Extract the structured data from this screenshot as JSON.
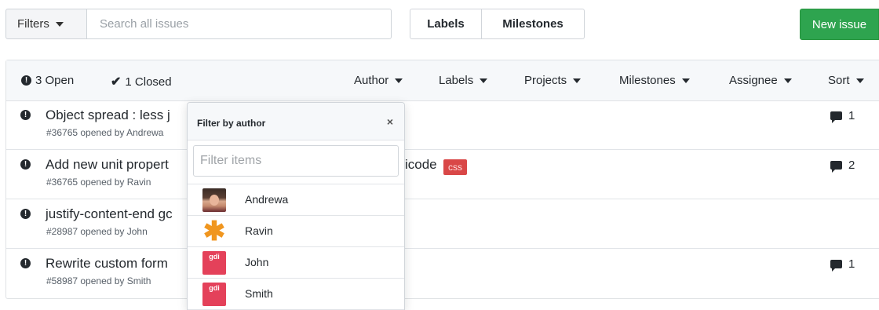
{
  "toolbar": {
    "filters_label": "Filters",
    "search_placeholder": "Search all issues",
    "labels_btn": "Labels",
    "milestones_btn": "Milestones",
    "new_issue_btn": "New issue"
  },
  "list_header": {
    "open_label": "3 Open",
    "closed_label": "1  Closed",
    "filters": [
      "Author",
      "Labels",
      "Projects",
      "Milestones",
      "Assignee",
      "Sort"
    ]
  },
  "issues": [
    {
      "title": "Object spread : less j",
      "meta": "#36765 opened by Andrewa",
      "comments": "1",
      "label": ""
    },
    {
      "title": "Add new unit propert",
      "title_tail": "icode",
      "meta": "#36765 opened by Ravin",
      "comments": "2",
      "label": "css"
    },
    {
      "title": "justify-content-end gc",
      "meta": "#28987 opened by John",
      "comments": "",
      "label": ""
    },
    {
      "title": "Rewrite custom form",
      "meta": "#58987 opened by Smith",
      "comments": "1",
      "label": ""
    }
  ],
  "author_dropdown": {
    "title": "Filter by author",
    "close_icon": "×",
    "filter_placeholder": "Filter items",
    "items": [
      {
        "name": "Andrewa",
        "avatar": "photo-avatar"
      },
      {
        "name": "Ravin",
        "avatar": "asterisk-avatar"
      },
      {
        "name": "John",
        "avatar": "gdi-logo-avatar",
        "logo_text": "gdi"
      },
      {
        "name": "Smith",
        "avatar": "gdi-logo-avatar",
        "logo_text": "gdi"
      }
    ]
  },
  "colors": {
    "new_issue_bg": "#2ea44f",
    "css_label_bg": "#d94747",
    "header_bg": "#f6f8fa"
  }
}
